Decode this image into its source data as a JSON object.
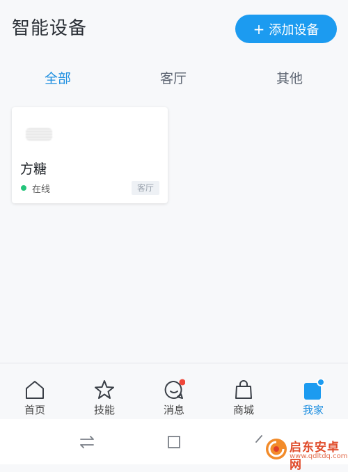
{
  "header": {
    "title": "智能设备",
    "add_button_plus": "+",
    "add_button_label": "添加设备"
  },
  "tabs": [
    {
      "label": "全部",
      "active": true
    },
    {
      "label": "客厅",
      "active": false
    },
    {
      "label": "其他",
      "active": false
    }
  ],
  "device": {
    "name": "方糖",
    "status": "在线",
    "status_color": "#24c47a",
    "room": "客厅"
  },
  "tabbar": {
    "items": [
      {
        "label": "首页",
        "icon": "home-icon"
      },
      {
        "label": "技能",
        "icon": "star-icon"
      },
      {
        "label": "消息",
        "icon": "message-icon",
        "badge": true
      },
      {
        "label": "商城",
        "icon": "shopping-bag-icon"
      },
      {
        "label": "我家",
        "icon": "my-home-icon",
        "active": true,
        "badge": true
      }
    ]
  },
  "system_nav": [
    "recent-apps-icon",
    "home-square-icon",
    "back-icon"
  ],
  "watermark": {
    "title": "启东安卓网",
    "url": "www.qdltdq.com"
  },
  "colors": {
    "accent": "#1c9bf0",
    "active_text": "#1f8fe0",
    "online": "#24c47a",
    "badge": "#f0473a"
  }
}
